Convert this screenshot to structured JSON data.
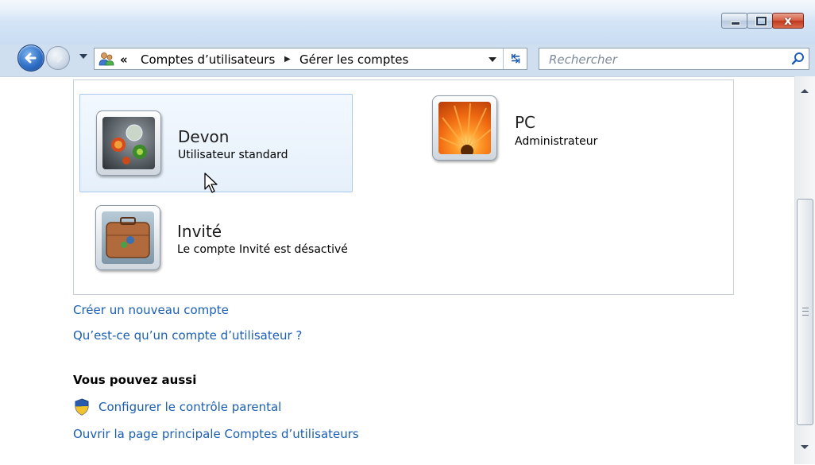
{
  "window": {
    "caption_buttons": {
      "minimize": "—",
      "maximize": "☐",
      "close": "x"
    }
  },
  "nav": {
    "breadcrumb_prefix": "«",
    "breadcrumb": [
      "Comptes d’utilisateurs",
      "Gérer les comptes"
    ],
    "search_placeholder": "Rechercher"
  },
  "accounts": [
    {
      "name": "Devon",
      "role": "Utilisateur standard",
      "picture": "chess-pieces",
      "selected": true
    },
    {
      "name": "PC",
      "role": "Administrateur",
      "picture": "orange-flower",
      "selected": false
    },
    {
      "name": "Invité",
      "role": "Le compte Invité est désactivé",
      "picture": "suitcase",
      "selected": false
    }
  ],
  "links": {
    "create_account": "Créer un nouveau compte",
    "what_is_account": "Qu’est-ce qu’un compte d’utilisateur ?"
  },
  "also": {
    "heading": "Vous pouvez aussi",
    "parental_control": "Configurer le contrôle parental",
    "main_page": "Ouvrir la page principale Comptes d’utilisateurs"
  },
  "colors": {
    "link": "#1a5fb4",
    "selection_border": "#a8c8ec"
  }
}
